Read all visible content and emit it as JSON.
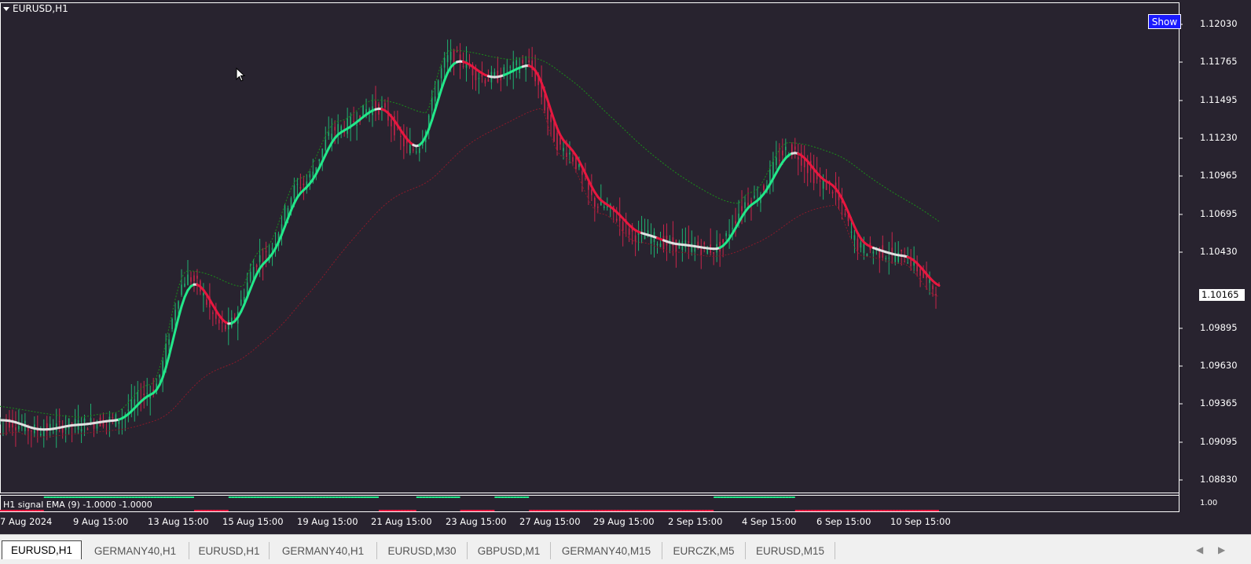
{
  "window": {
    "title": "EURUSD,H1",
    "show_button": "Show"
  },
  "indicator": {
    "label": "H1 signal EMA (9) -1.0000 -1.0000",
    "scale_label": "1.00"
  },
  "price_axis": {
    "labels": [
      "1.12030",
      "1.11765",
      "1.11495",
      "1.11230",
      "1.10965",
      "1.10695",
      "1.10430",
      "1.09895",
      "1.09630",
      "1.09365",
      "1.09095",
      "1.08830"
    ],
    "current_price": "1.10165"
  },
  "time_axis": [
    "7 Aug 2024",
    "9 Aug 15:00",
    "13 Aug 15:00",
    "15 Aug 15:00",
    "19 Aug 15:00",
    "21 Aug 15:00",
    "23 Aug 15:00",
    "27 Aug 15:00",
    "29 Aug 15:00",
    "2 Sep 15:00",
    "4 Sep 15:00",
    "6 Sep 15:00",
    "10 Sep 15:00"
  ],
  "tabs": [
    "EURUSD,H1",
    "GERMANY40,H1",
    "EURUSD,H1",
    "GERMANY40,H1",
    "EURUSD,M30",
    "GBPUSD,M1",
    "GERMANY40,M15",
    "EURCZK,M5",
    "EURUSD,M15"
  ],
  "colors": {
    "background": "#28232f",
    "bull": "#22e88a",
    "bear": "#e8173f",
    "neutral": "#e0e0e0",
    "upper_band": "#1a8c1a",
    "lower_band": "#8c1a2a"
  },
  "chart_data": {
    "type": "line",
    "title": "EURUSD,H1",
    "ylim": [
      1.0875,
      1.1215
    ],
    "xlim": [
      "7 Aug 2024",
      "12 Sep"
    ],
    "x": [
      "7 Aug",
      "8 Aug",
      "9 Aug",
      "12 Aug",
      "13 Aug",
      "14 Aug",
      "15 Aug",
      "16 Aug",
      "19 Aug",
      "20 Aug",
      "21 Aug",
      "22 Aug",
      "23 Aug",
      "26 Aug",
      "27 Aug",
      "28 Aug",
      "29 Aug",
      "30 Aug",
      "2 Sep",
      "3 Sep",
      "4 Sep",
      "5 Sep",
      "6 Sep",
      "9 Sep",
      "10 Sep",
      "11 Sep"
    ],
    "series": [
      {
        "values": [
          1.0925,
          1.0918,
          1.0922,
          1.0925,
          1.0945,
          1.1025,
          1.099,
          1.104,
          1.109,
          1.113,
          1.1145,
          1.1115,
          1.118,
          1.1165,
          1.1175,
          1.1115,
          1.1075,
          1.1055,
          1.1048,
          1.1045,
          1.108,
          1.1115,
          1.109,
          1.1045,
          1.104,
          1.1017
        ]
      }
    ]
  }
}
